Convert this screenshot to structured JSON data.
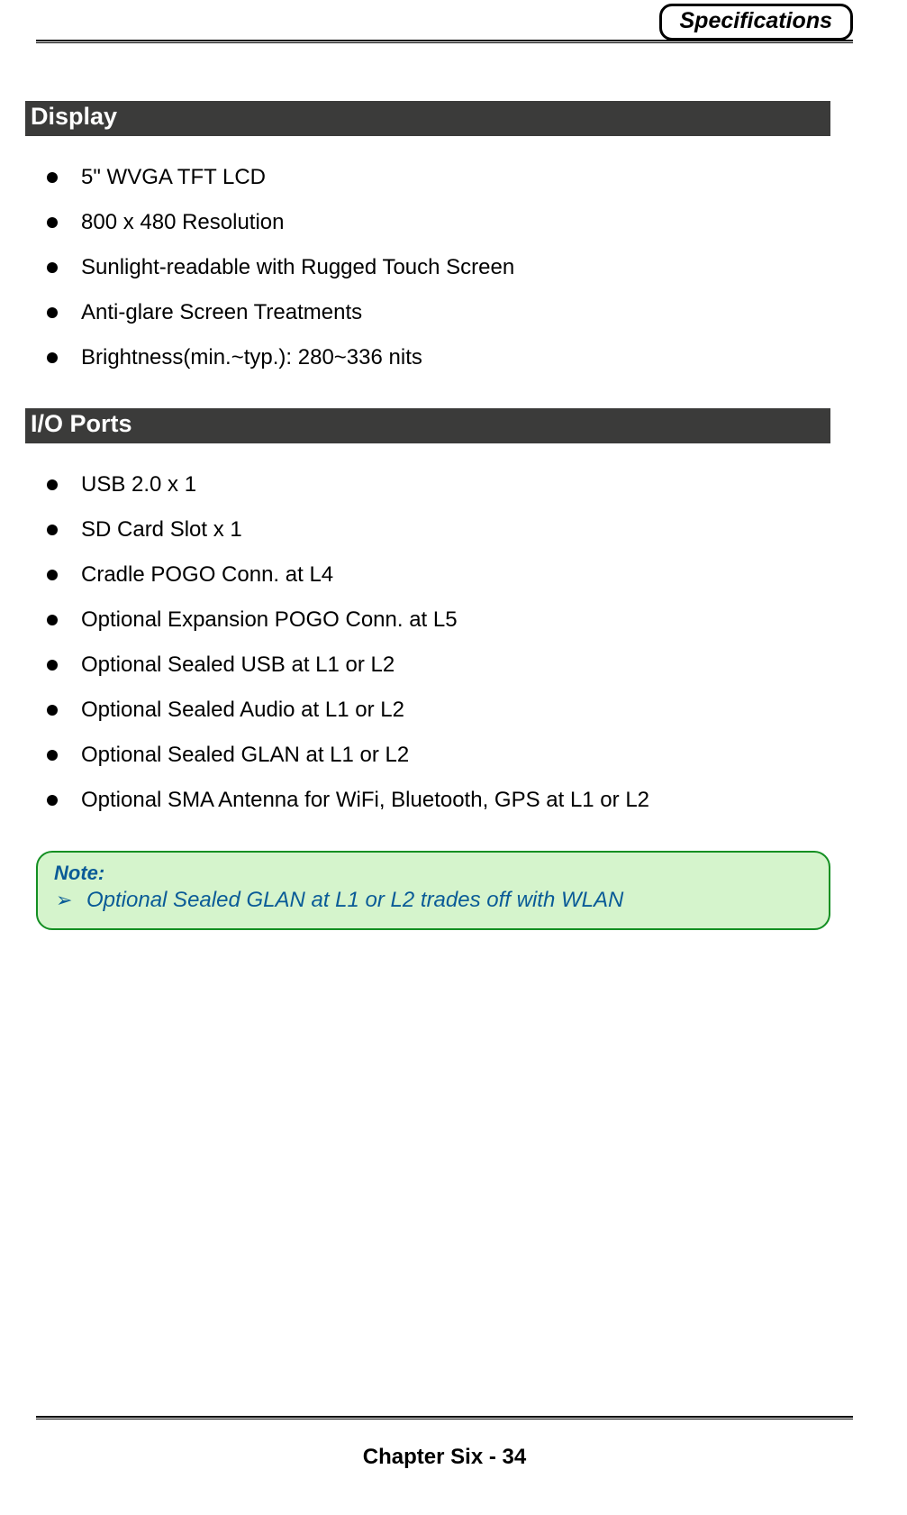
{
  "header": {
    "title": "Specifications"
  },
  "sections": {
    "display": {
      "title": "Display",
      "items": [
        "5\" WVGA TFT LCD",
        "800 x 480 Resolution",
        "Sunlight-readable with Rugged Touch Screen",
        "Anti-glare Screen Treatments",
        "Brightness(min.~typ.): 280~336 nits"
      ]
    },
    "ioports": {
      "title": "I/O Ports",
      "items": [
        "USB 2.0 x 1",
        "SD Card Slot x 1",
        "Cradle POGO Conn. at L4",
        "Optional Expansion POGO Conn. at L5",
        "Optional Sealed USB at L1 or L2",
        "Optional Sealed Audio at L1 or L2",
        "Optional Sealed GLAN at L1 or L2",
        "Optional SMA Antenna for WiFi, Bluetooth, GPS at L1 or L2"
      ]
    }
  },
  "note": {
    "label": "Note:",
    "text": "Optional Sealed GLAN at L1 or L2 trades off with WLAN"
  },
  "footer": {
    "text": "Chapter Six - 34"
  }
}
